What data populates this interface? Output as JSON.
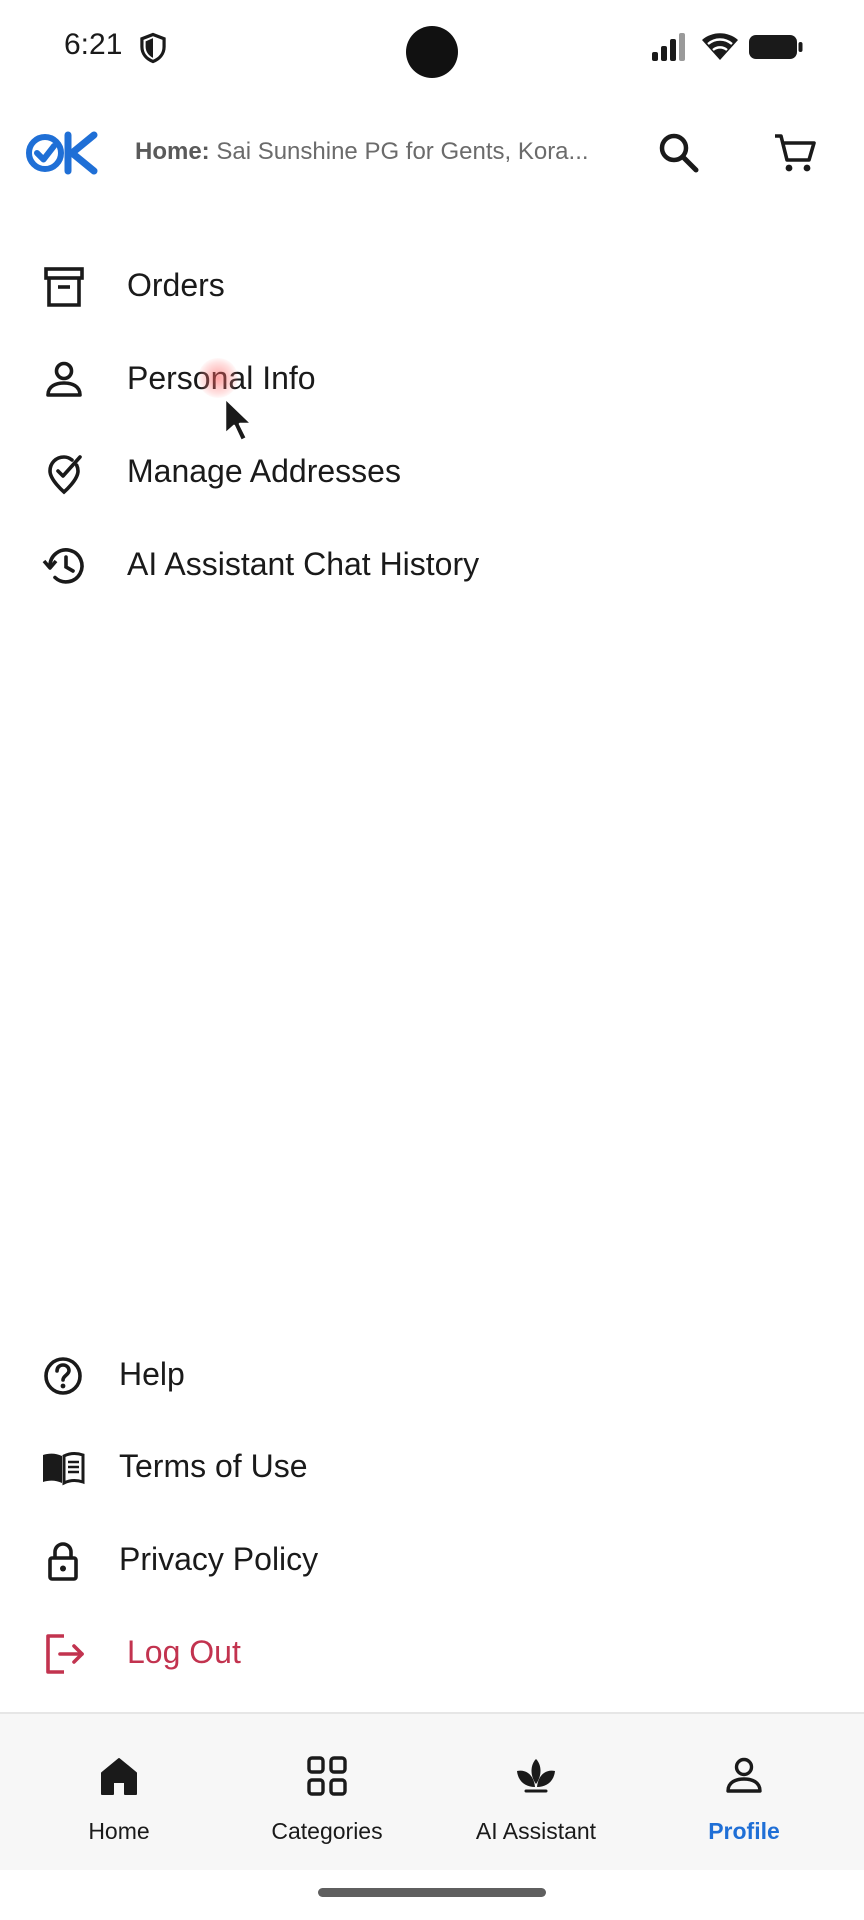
{
  "status_bar": {
    "time": "6:21"
  },
  "header": {
    "address_label": "Home:",
    "address_value": "Sai Sunshine PG for Gents, Kora..."
  },
  "top_menu": [
    {
      "label": "Orders",
      "icon": "archive-icon"
    },
    {
      "label": "Personal Info",
      "icon": "person-icon"
    },
    {
      "label": "Manage Addresses",
      "icon": "location-check-icon"
    },
    {
      "label": "AI Assistant Chat History",
      "icon": "history-icon"
    }
  ],
  "bottom_menu": [
    {
      "label": "Help",
      "icon": "help-circle-icon"
    },
    {
      "label": "Terms of Use",
      "icon": "book-icon"
    },
    {
      "label": "Privacy Policy",
      "icon": "lock-icon"
    },
    {
      "label": "Log Out",
      "icon": "logout-icon"
    }
  ],
  "bottom_nav": [
    {
      "label": "Home",
      "icon": "home-icon"
    },
    {
      "label": "Categories",
      "icon": "grid-icon"
    },
    {
      "label": "AI Assistant",
      "icon": "leaf-icon"
    },
    {
      "label": "Profile",
      "icon": "profile-icon",
      "active": true
    }
  ],
  "colors": {
    "brand_blue": "#1f6fd6",
    "logout_red": "#c2334f",
    "text": "#1a1a1a",
    "muted": "#6b6b6b"
  }
}
